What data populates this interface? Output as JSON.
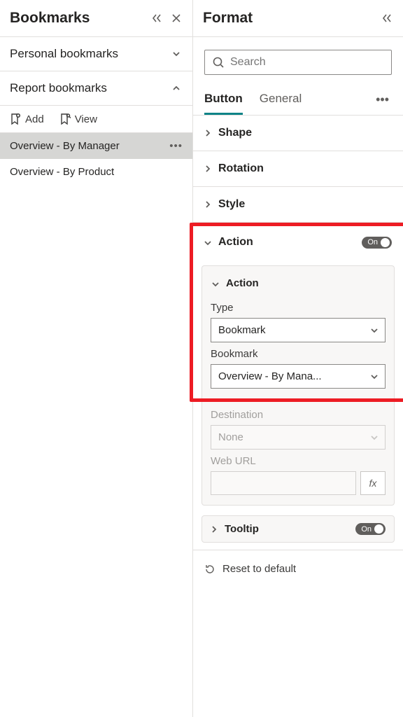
{
  "bookmarks_panel": {
    "title": "Bookmarks",
    "sections": {
      "personal": {
        "label": "Personal bookmarks",
        "expanded": false
      },
      "report": {
        "label": "Report bookmarks",
        "expanded": true
      }
    },
    "toolbar": {
      "add_label": "Add",
      "view_label": "View"
    },
    "items": [
      {
        "label": "Overview - By Manager",
        "selected": true
      },
      {
        "label": "Overview - By Product",
        "selected": false
      }
    ]
  },
  "format_panel": {
    "title": "Format",
    "search": {
      "placeholder": "Search"
    },
    "tabs": {
      "button": "Button",
      "general": "General"
    },
    "sections": {
      "shape": "Shape",
      "rotation": "Rotation",
      "style": "Style",
      "action": "Action",
      "tooltip": "Tooltip"
    },
    "action_card": {
      "header": "Action",
      "type_label": "Type",
      "type_value": "Bookmark",
      "bookmark_label": "Bookmark",
      "bookmark_value": "Overview - By Mana...",
      "destination_label": "Destination",
      "destination_value": "None",
      "weburl_label": "Web URL",
      "fx_label": "fx"
    },
    "toggle_on": "On",
    "reset_label": "Reset to default"
  }
}
